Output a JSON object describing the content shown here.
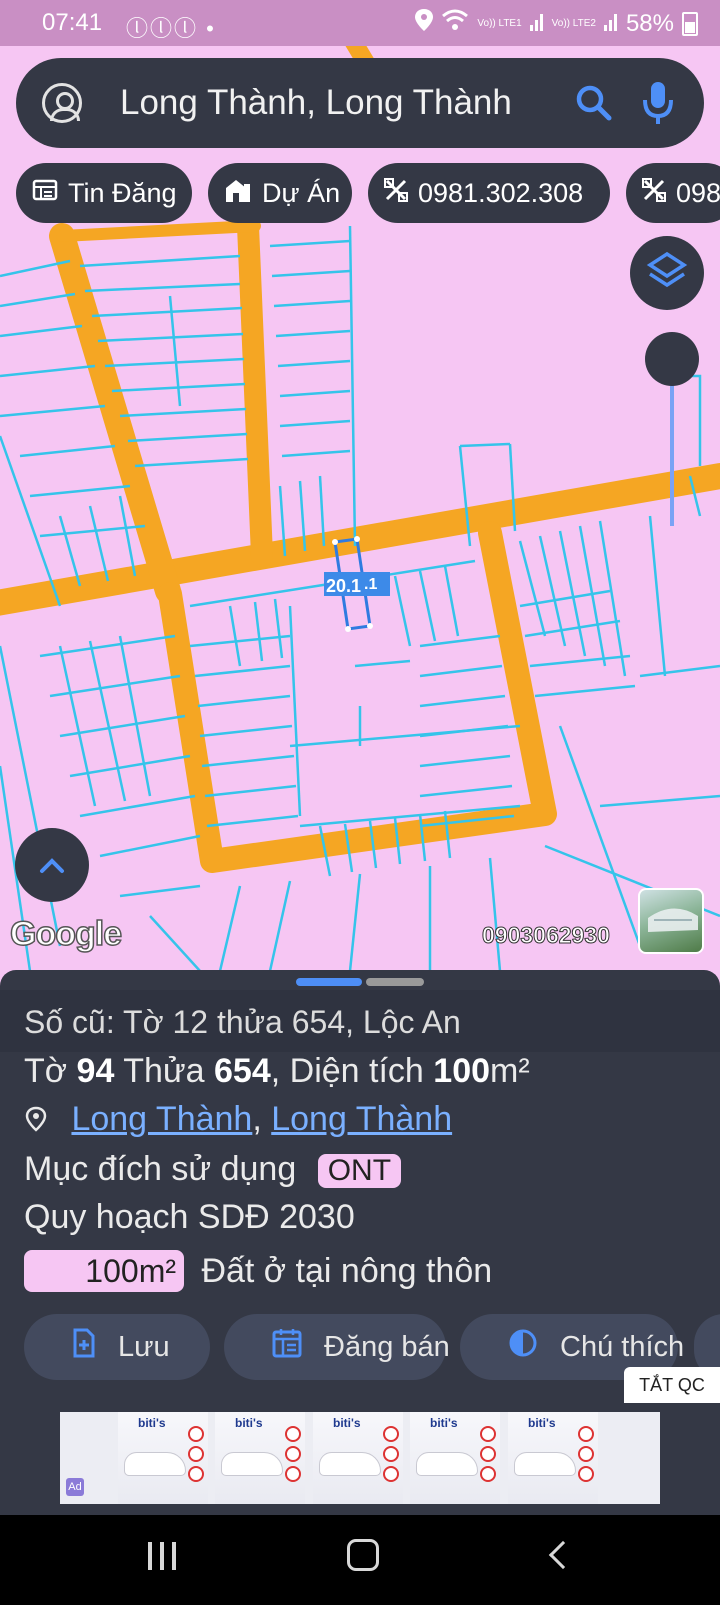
{
  "status_bar": {
    "time": "07:41",
    "notification_icons": "ⓛⓛⓛ •",
    "sim1": "Vo)) LTE1",
    "sim2": "Vo)) LTE2",
    "battery": "58%"
  },
  "search": {
    "query": "Long Thành, Long Thành",
    "icons": [
      "account-icon",
      "search-icon",
      "mic-icon"
    ]
  },
  "chips": [
    {
      "label": "Tin Đăng",
      "icon": "listing-icon"
    },
    {
      "label": "Dự Án",
      "icon": "building-icon"
    },
    {
      "label": "0981.302.308",
      "icon": "tools-icon"
    },
    {
      "label": "098",
      "icon": "tools-icon"
    }
  ],
  "map": {
    "parcel_label": "20.1",
    "parcel_label_suffix": ".1",
    "watermark": "Google",
    "phone_overlay": "0903062930",
    "colors": {
      "land": "#f6c6f3",
      "road": "#f5a623",
      "lot_lines": "#35c4ea",
      "selected": "#2f7be0"
    }
  },
  "sheet": {
    "old_number": "Số cũ: Tờ 12 thửa 654, Lộc An",
    "to_label": "Tờ",
    "to_value": "94",
    "thua_label": "Thửa",
    "thua_value": "654",
    "area_label": ", Diện tích",
    "area_value": "100",
    "area_unit": "m²",
    "location_district": "Long Thành",
    "location_separator": ",",
    "location_ward": "Long Thành",
    "usage_label": "Mục đích sử dụng",
    "usage_code": "ONT",
    "plan_label": "Quy hoạch SDĐ 2030",
    "plan_area": "100m²",
    "plan_desc": "Đất ở tại nông thôn"
  },
  "actions": [
    {
      "label": "Lưu",
      "icon": "save-file-icon"
    },
    {
      "label": "Đăng bán",
      "icon": "calendar-icon"
    },
    {
      "label": "Chú thích",
      "icon": "legend-icon"
    }
  ],
  "ad": {
    "close_label": "TẮT QC",
    "brand": "biti's",
    "mark": "Ad"
  }
}
